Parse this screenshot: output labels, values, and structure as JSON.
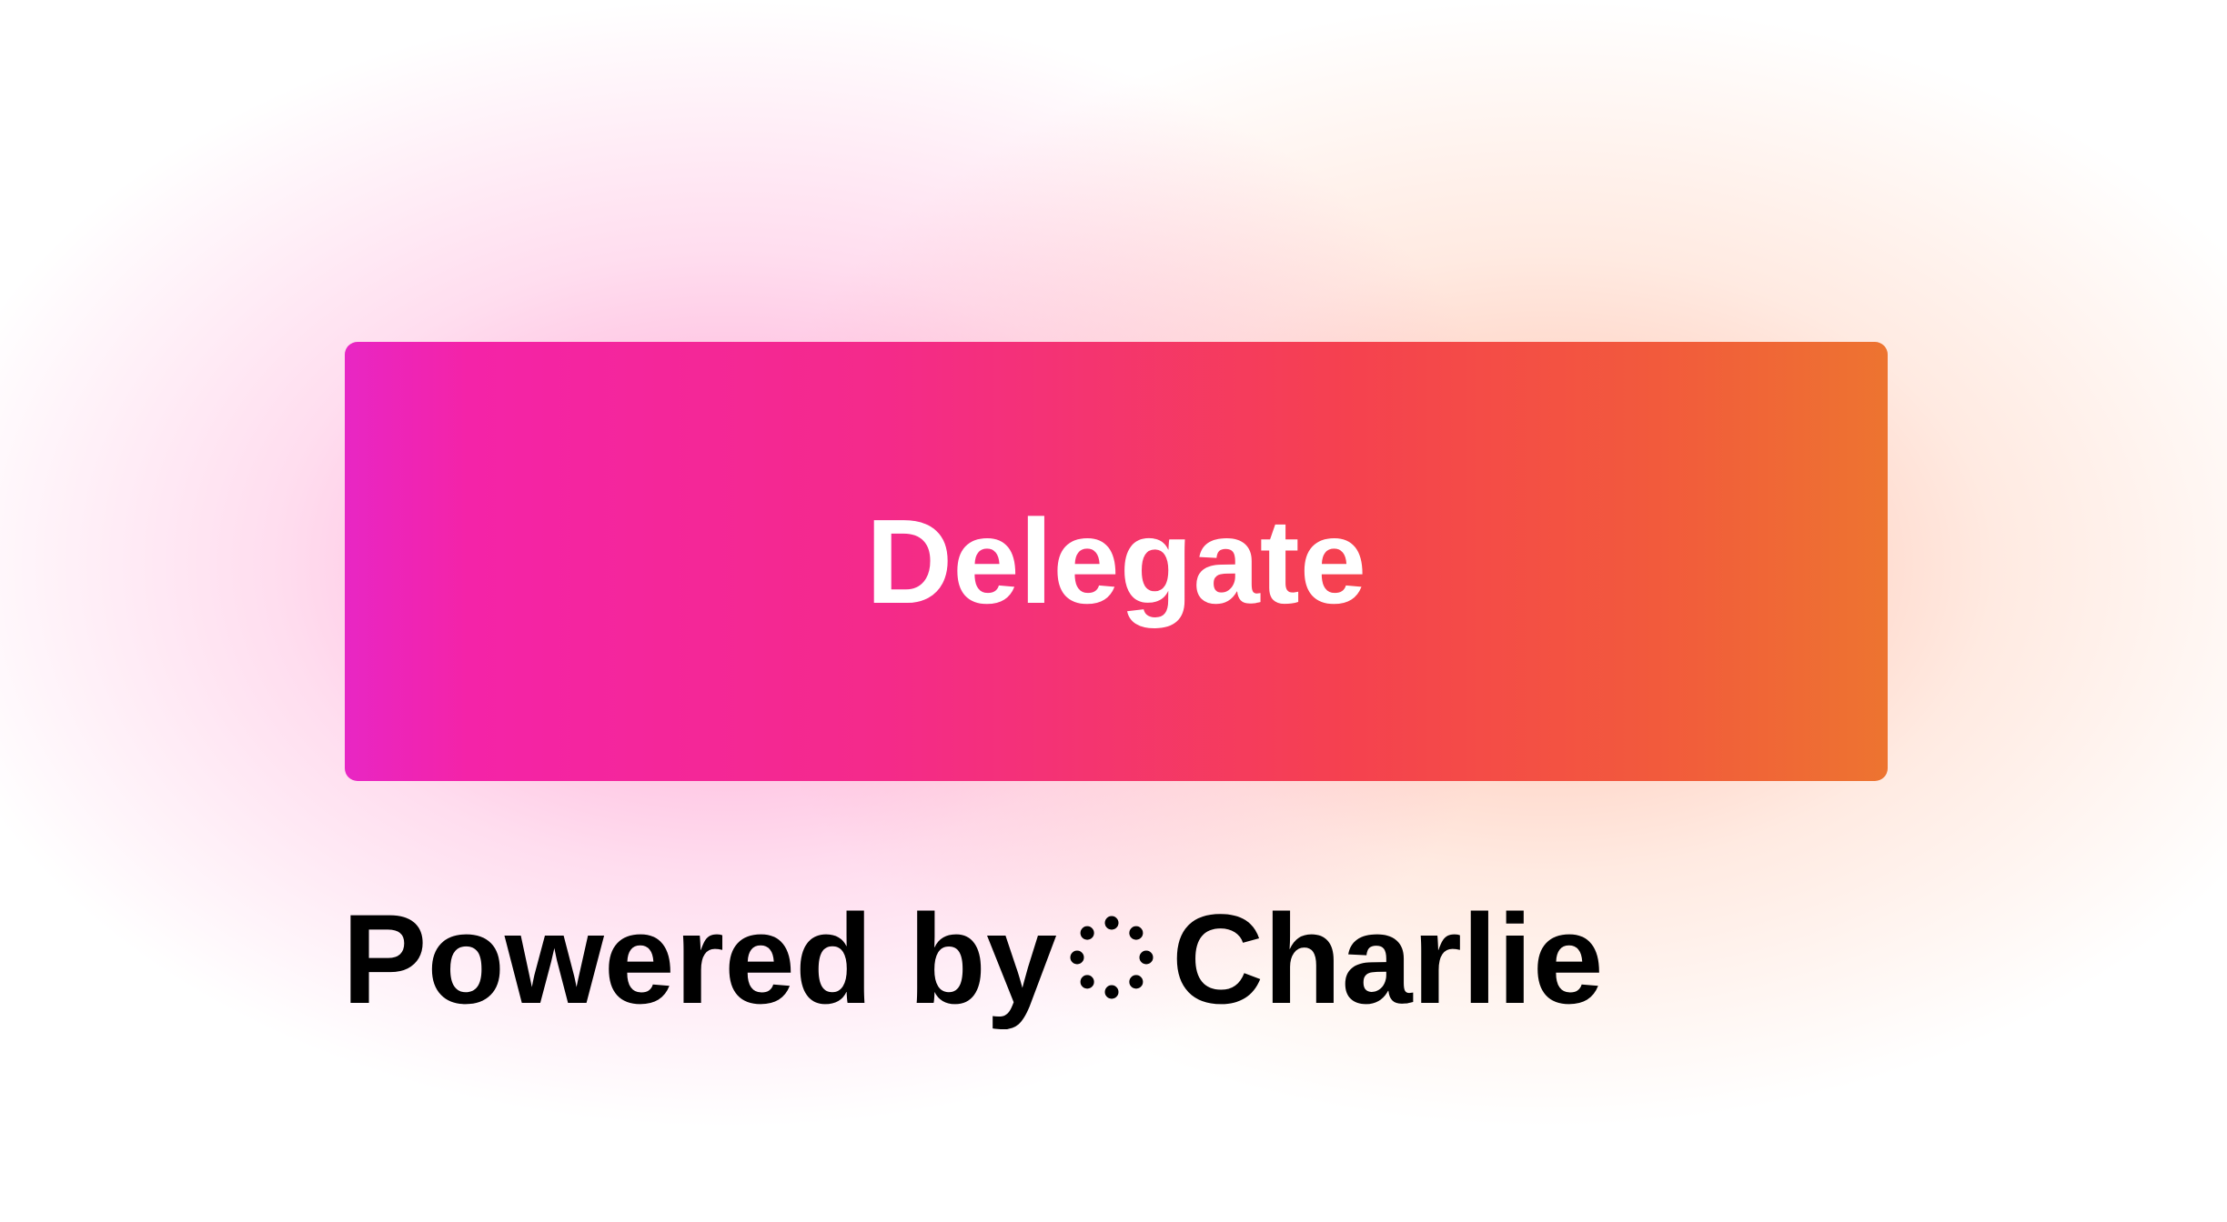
{
  "button": {
    "label": "Delegate",
    "gradient_colors": [
      "#e826c4",
      "#f423a8",
      "#f5414f",
      "#ed7430"
    ]
  },
  "footer": {
    "powered_by": "Powered by",
    "brand_icon": "dotted-circle-icon",
    "brand_name": "Charlie"
  }
}
